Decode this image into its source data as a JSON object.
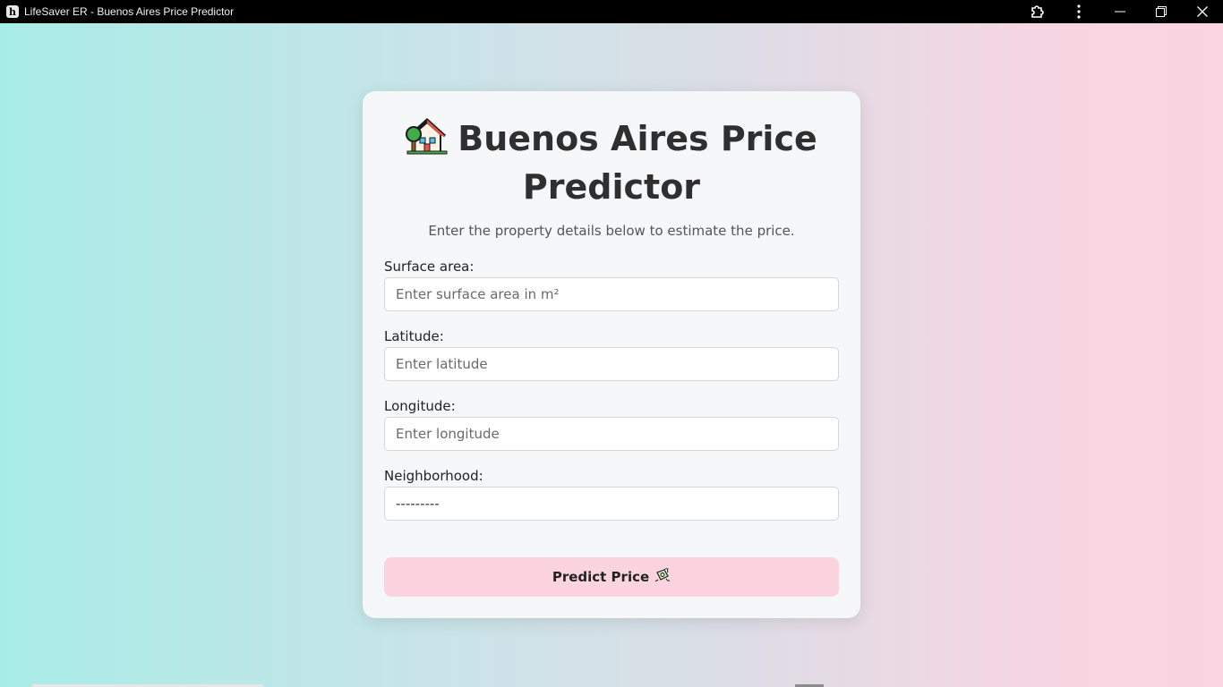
{
  "window": {
    "title": "LifeSaver ER - Buenos Aires Price Predictor",
    "logo_letter": "h",
    "controls": [
      "extensions-icon",
      "more-vertical-icon",
      "minimize-icon",
      "restore-icon",
      "close-icon"
    ]
  },
  "colors": {
    "gradient_left": "#a8ece8",
    "gradient_right": "#fbd5e1",
    "card_bg": "#f6f7f9",
    "button_bg": "#fcd4e0",
    "title_text": "#2f2f2f"
  },
  "card": {
    "title_icon": "house-with-garden-icon",
    "title": "Buenos Aires Price Predictor",
    "subtitle": "Enter the property details below to estimate the price."
  },
  "form": {
    "surface_area": {
      "label": "Surface area:",
      "placeholder": "Enter surface area in m²",
      "value": ""
    },
    "latitude": {
      "label": "Latitude:",
      "placeholder": "Enter latitude",
      "value": ""
    },
    "longitude": {
      "label": "Longitude:",
      "placeholder": "Enter longitude",
      "value": ""
    },
    "neighborhood": {
      "label": "Neighborhood:",
      "selected": "---------"
    },
    "submit": {
      "label": "Predict Price",
      "icon": "money-with-wings-icon"
    }
  }
}
